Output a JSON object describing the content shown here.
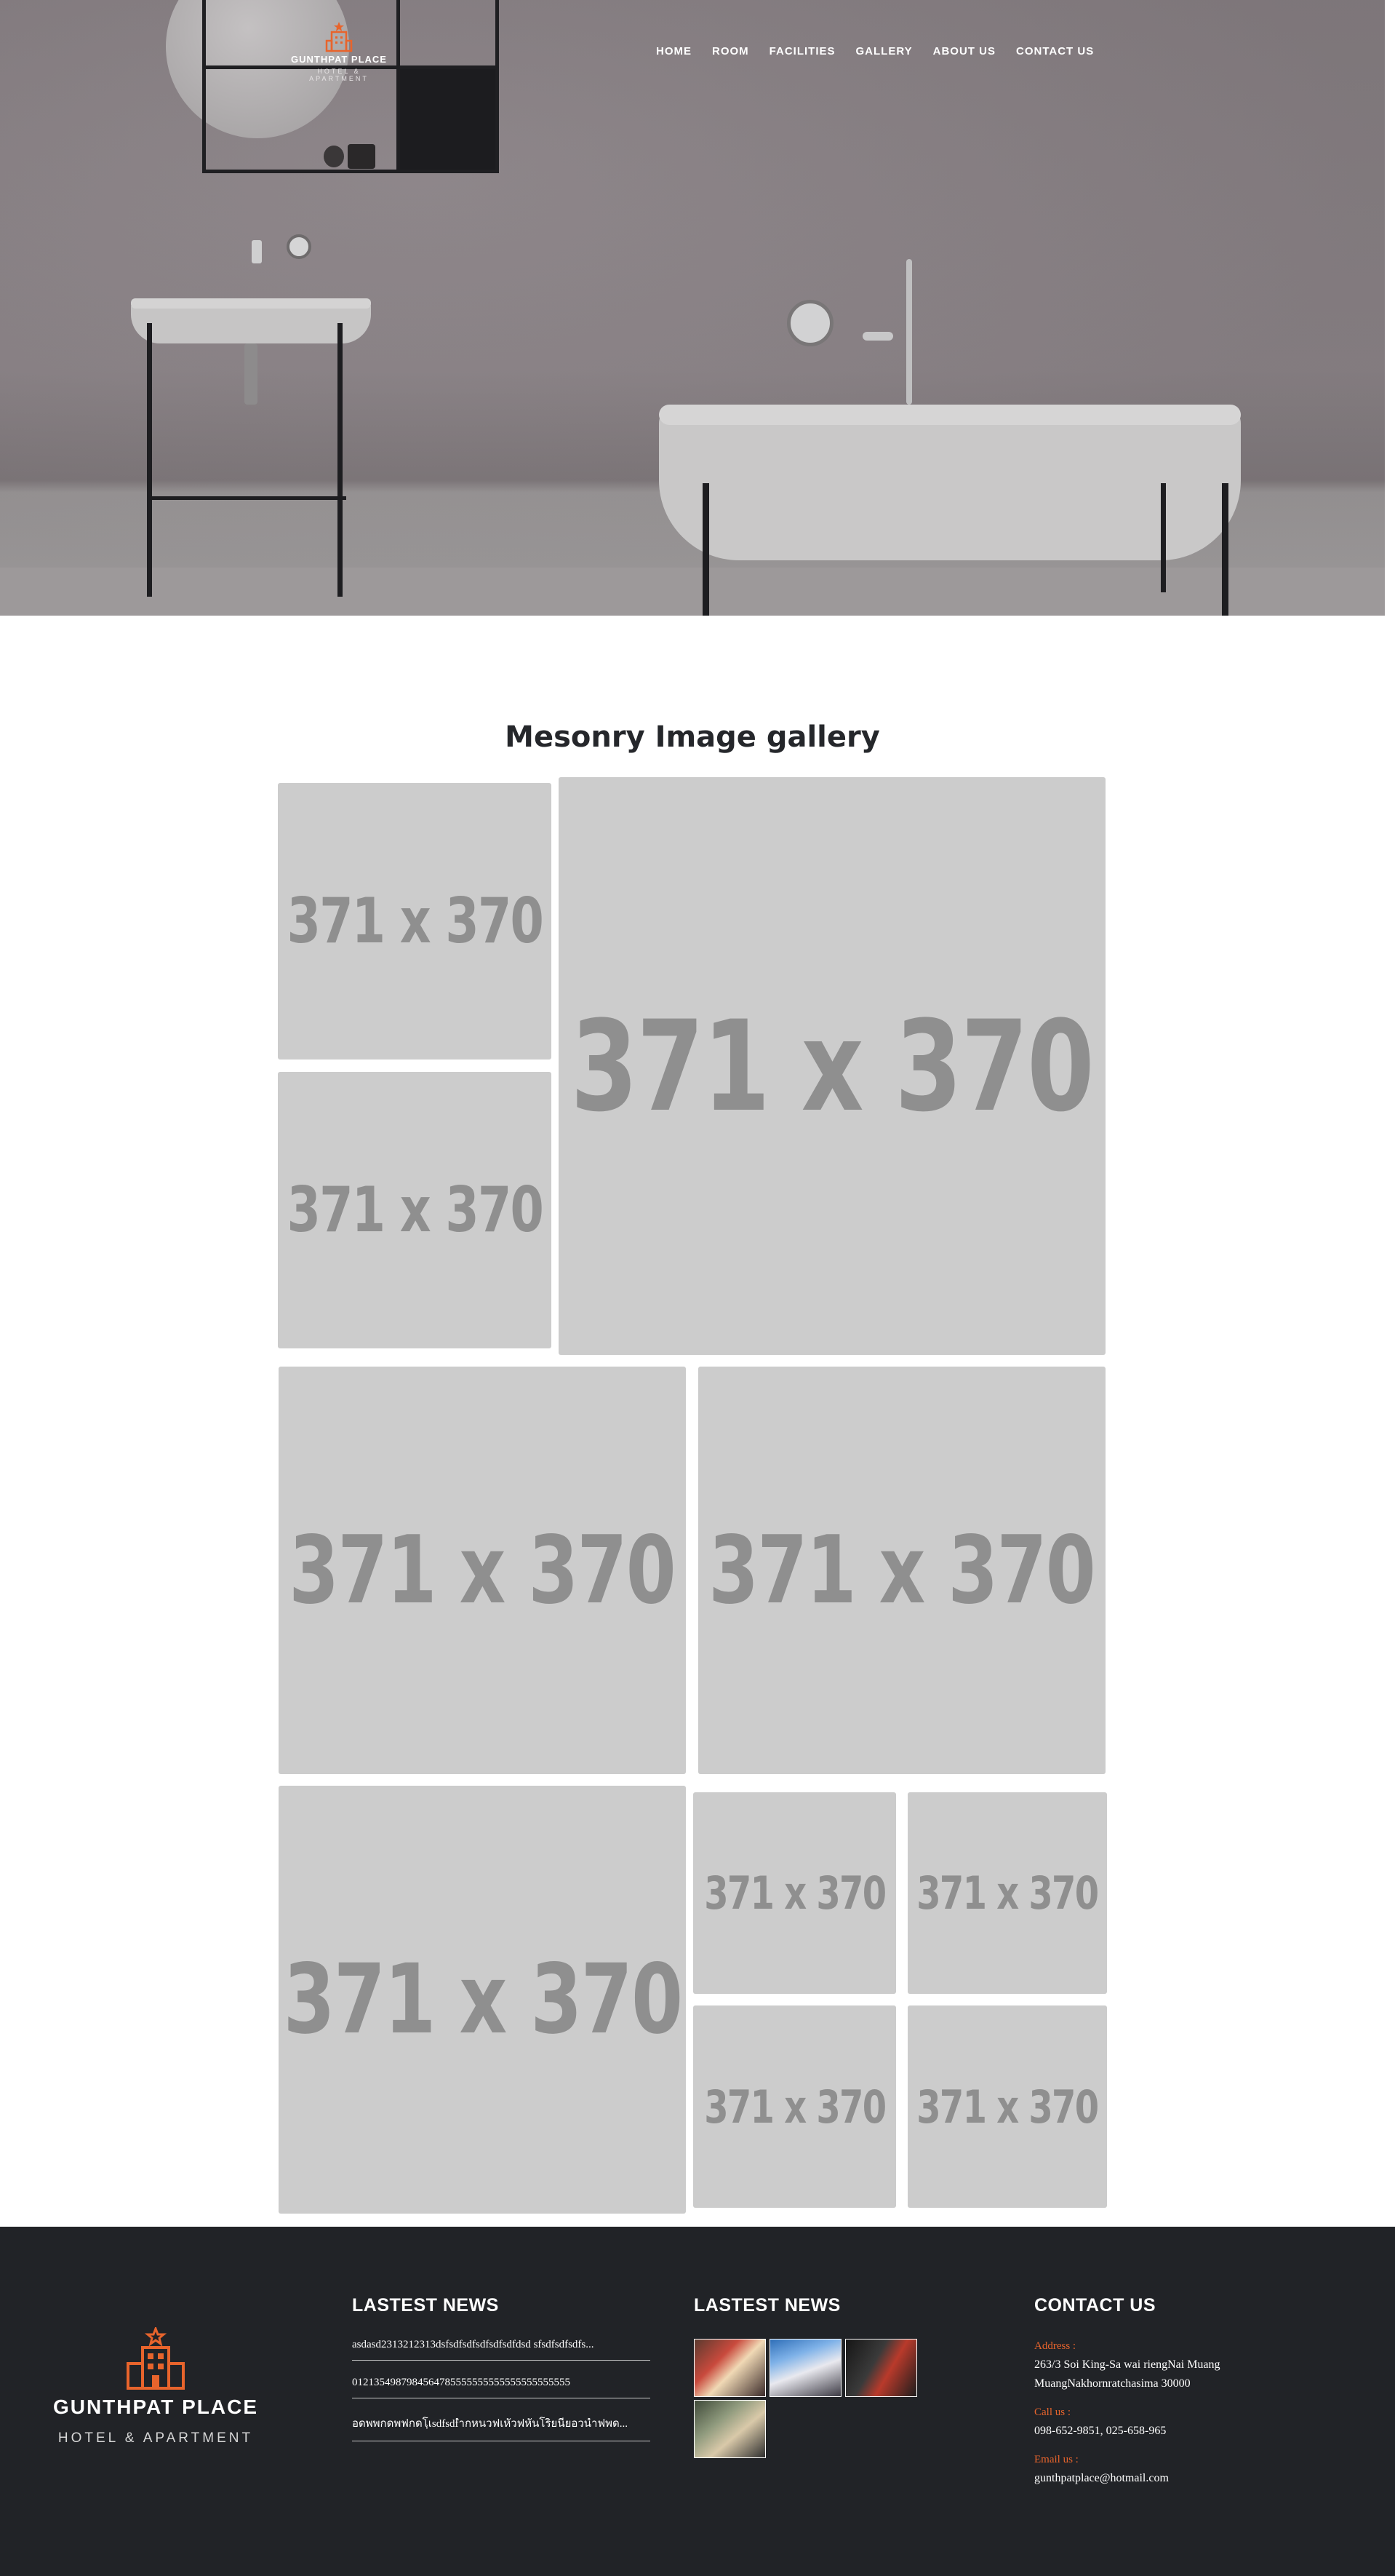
{
  "brand": {
    "name": "GUNTHPAT PLACE",
    "tagline": "HOTEL & APARTMENT",
    "accent_color": "#e8642c",
    "logo_icon": "hotel-building-icon"
  },
  "nav": {
    "items": [
      "HOME",
      "ROOM",
      "FACILITIES",
      "GALLERY",
      "ABOUT US",
      "CONTACT US"
    ]
  },
  "gallery": {
    "title": "Mesonry Image gallery",
    "placeholder_label": "371 x 370",
    "tile_count": 11
  },
  "footer": {
    "news_heading_1": "LASTEST NEWS",
    "news_heading_2": "LASTEST NEWS",
    "contact_heading": "CONTACT US",
    "news_items": [
      "asdasd2313212313dsfsdfsdfsdfsdfsdfdsd sfsdfsdfsdfs...",
      "0121354987984564785555555555555555555555",
      "อดพพกดพฟกดโฺเsdfsdfำกหนวฟเหัวฟหันโริยนียอวนําฟพด..."
    ],
    "thumbnail_count": 4,
    "contact": {
      "address_label": "Address :",
      "address_line1": "263/3 Soi King-Sa wai riengNai Muang",
      "address_line2": "MuangNakhornratchasima 30000",
      "call_label": "Call us :",
      "phone": "098-652-9851, 025-658-965",
      "email_label": "Email us :",
      "email": "gunthpatplace@hotmail.com"
    }
  }
}
